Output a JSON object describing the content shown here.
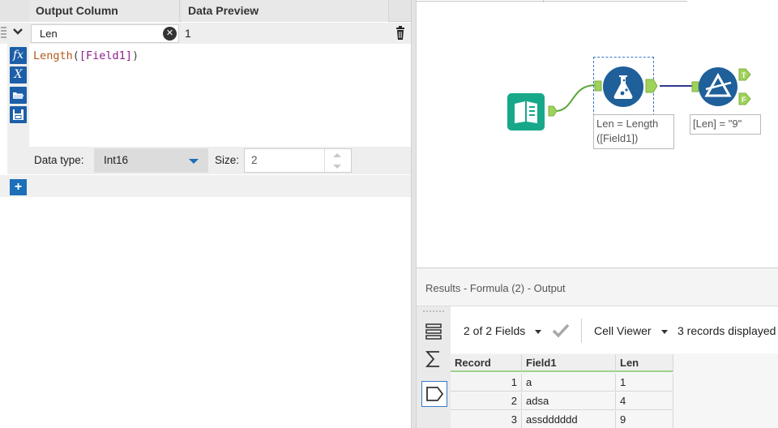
{
  "formula_panel": {
    "headers": {
      "output_column": "Output Column",
      "data_preview": "Data Preview"
    },
    "row": {
      "name": "Len",
      "preview": "1"
    },
    "expression": {
      "func": "Length",
      "open": "(",
      "field": "[Field1]",
      "close": ")"
    },
    "data_type": {
      "label": "Data type:",
      "value": "Int16"
    },
    "size": {
      "label": "Size:",
      "value": "2"
    },
    "tool_buttons": [
      {
        "icon": "fx-icon",
        "glyph": "fx"
      },
      {
        "icon": "variable-icon",
        "glyph": "X"
      },
      {
        "icon": "open-folder-icon",
        "glyph": ""
      },
      {
        "icon": "save-icon",
        "glyph": ""
      }
    ],
    "add_button": "+",
    "accent": "#1c6fb8"
  },
  "canvas": {
    "formula_annotation": {
      "line1": "Len = Length",
      "line2": "([Field1])"
    },
    "filter_annotation": "[Len] = \"9\"",
    "filter_outputs": {
      "true": "T",
      "false": "F"
    },
    "colors": {
      "input_tool": "#17a88a",
      "formula_tool": "#1f5f9a",
      "connector": "#8bc34a",
      "connection_line": "#2d3a8c"
    }
  },
  "results": {
    "title": "Results - Formula (2) - Output",
    "fields_selector": "2 of 2 Fields",
    "cell_viewer": "Cell Viewer",
    "records_displayed": "3 records displayed",
    "columns": [
      "Record",
      "Field1",
      "Len"
    ],
    "rows": [
      {
        "record": "1",
        "field1": "a",
        "len": "1"
      },
      {
        "record": "2",
        "field1": "adsa",
        "len": "4"
      },
      {
        "record": "3",
        "field1": "assdddddd",
        "len": "9"
      }
    ]
  }
}
